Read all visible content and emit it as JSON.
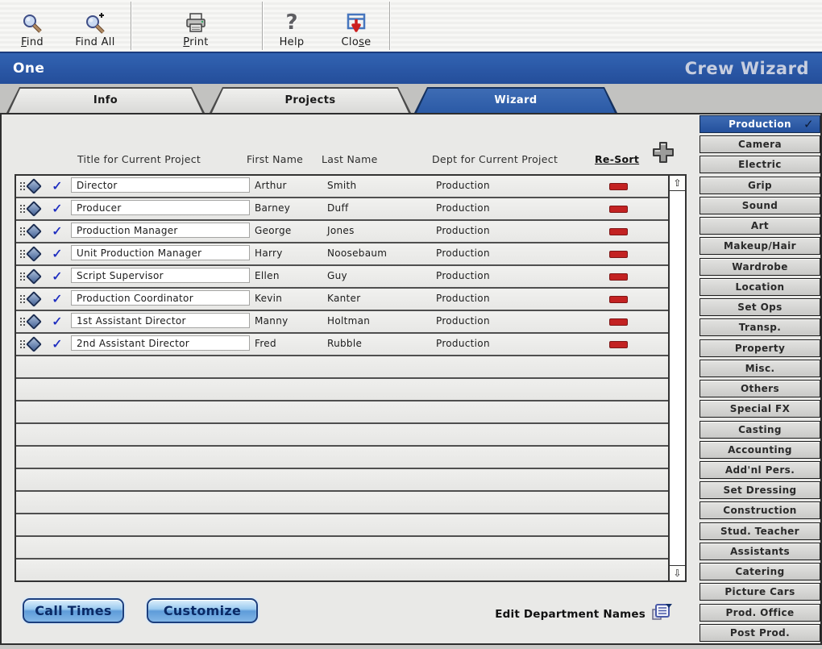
{
  "window": {
    "title_left": "One",
    "title_right": "Crew Wizard"
  },
  "toolbar": {
    "buttons": [
      {
        "label": "Find",
        "underline_index": 0,
        "icon": "magnifier-icon"
      },
      {
        "label": "Find All",
        "underline_index": -1,
        "icon": "magnifier-plus-icon"
      },
      {
        "label": "Print",
        "underline_index": 0,
        "icon": "printer-icon"
      },
      {
        "label": "Help",
        "underline_index": -1,
        "icon": "question-icon"
      },
      {
        "label": "Close",
        "underline_index": 3,
        "icon": "close-window-icon"
      }
    ]
  },
  "tabs": [
    {
      "label": "Info",
      "active": false
    },
    {
      "label": "Projects",
      "active": false
    },
    {
      "label": "Wizard",
      "active": true
    }
  ],
  "crew_table": {
    "headers": {
      "title": "Title for Current Project",
      "first_name": "First Name",
      "last_name": "Last Name",
      "dept": "Dept for Current Project",
      "resort": "Re-Sort"
    },
    "rows": [
      {
        "title": "Director",
        "first_name": "Arthur",
        "last_name": "Smith",
        "dept": "Production"
      },
      {
        "title": "Producer",
        "first_name": "Barney",
        "last_name": "Duff",
        "dept": "Production"
      },
      {
        "title": "Production Manager",
        "first_name": "George",
        "last_name": "Jones",
        "dept": "Production"
      },
      {
        "title": "Unit Production Manager",
        "first_name": "Harry",
        "last_name": "Noosebaum",
        "dept": "Production"
      },
      {
        "title": "Script Supervisor",
        "first_name": "Ellen",
        "last_name": "Guy",
        "dept": "Production"
      },
      {
        "title": "Production Coordinator",
        "first_name": "Kevin",
        "last_name": "Kanter",
        "dept": "Production"
      },
      {
        "title": "1st Assistant Director",
        "first_name": "Manny",
        "last_name": "Holtman",
        "dept": "Production"
      },
      {
        "title": "2nd Assistant Director",
        "first_name": "Fred",
        "last_name": "Rubble",
        "dept": "Production"
      }
    ],
    "empty_rows": 10
  },
  "departments": {
    "selected": "Production",
    "items": [
      "Production",
      "Camera",
      "Electric",
      "Grip",
      "Sound",
      "Art",
      "Makeup/Hair",
      "Wardrobe",
      "Location",
      "Set Ops",
      "Transp.",
      "Property",
      "Misc.",
      "Others",
      "Special FX",
      "Casting",
      "Accounting",
      "Add'nl Pers.",
      "Set Dressing",
      "Construction",
      "Stud. Teacher",
      "Assistants",
      "Catering",
      "Picture Cars",
      "Prod. Office",
      "Post Prod."
    ]
  },
  "footer": {
    "call_times": "Call Times",
    "customize": "Customize",
    "edit_departments": "Edit Department Names"
  },
  "icons": {
    "scroll_up": "⇧",
    "scroll_down": "⇩",
    "row_check": "✓",
    "dept_check": "✓"
  },
  "colors": {
    "accent_blue": "#2B5AA6",
    "titlebar_blue": "#2A57A5",
    "remove_red": "#C32222",
    "row_check_blue": "#1E2EC0",
    "button_face_blue": "#82B6E6"
  }
}
